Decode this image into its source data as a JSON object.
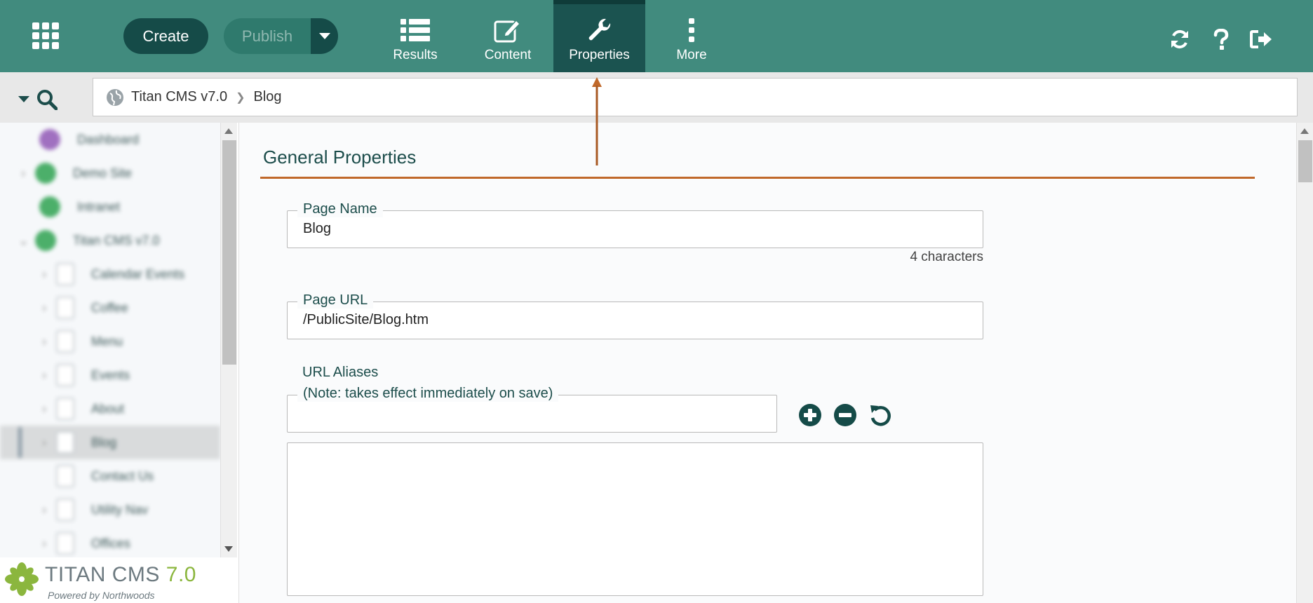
{
  "topbar": {
    "create_label": "Create",
    "publish_label": "Publish",
    "nav": [
      {
        "label": "Results",
        "icon": "list-icon"
      },
      {
        "label": "Content",
        "icon": "edit-icon"
      },
      {
        "label": "Properties",
        "icon": "wrench-icon",
        "active": true
      },
      {
        "label": "More",
        "icon": "vertical-dots-icon"
      }
    ],
    "right_icons": [
      "refresh-icon",
      "help-icon",
      "logout-icon"
    ],
    "colors": {
      "bar": "#418b7e",
      "dark": "#154b48",
      "active": "#1b5350"
    }
  },
  "breadcrumb": {
    "items": [
      "Titan CMS v7.0",
      "Blog"
    ]
  },
  "tree": {
    "items": [
      "Dashboard",
      "Demo Site",
      "Intranet",
      "Titan CMS v7.0",
      "Calendar Events",
      "Coffee",
      "Menu",
      "Events",
      "About",
      "Blog",
      "Contact Us",
      "Utility Nav",
      "Offices"
    ],
    "selected": "Blog"
  },
  "logo": {
    "name": "TITAN CMS",
    "version": "7.0",
    "tagline": "Powered by Northwoods"
  },
  "main": {
    "section_title": "General Properties",
    "page_name": {
      "label": "Page Name",
      "value": "Blog",
      "count": "4 characters"
    },
    "page_url": {
      "label": "Page URL",
      "value": "/PublicSite/Blog.htm"
    },
    "url_aliases": {
      "label": "URL Aliases",
      "note": "(Note: takes effect immediately on save)",
      "value": ""
    },
    "accent_color": "#c0682a"
  }
}
